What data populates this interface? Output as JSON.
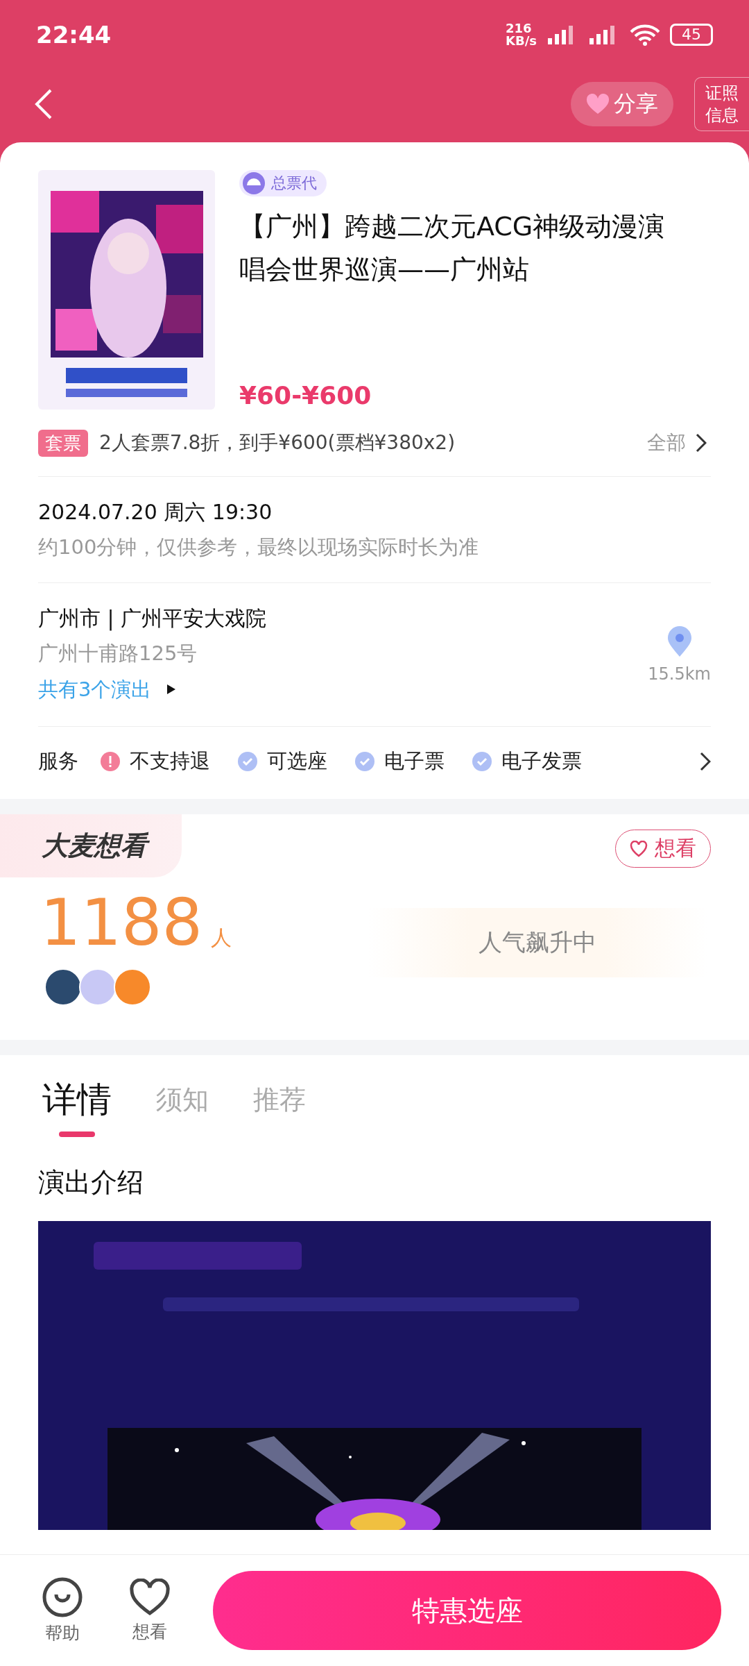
{
  "status_bar": {
    "time": "22:44",
    "net_speed": "216",
    "net_unit": "KB/s",
    "battery": "45"
  },
  "header": {
    "share": "分享",
    "license": "证照信息"
  },
  "event": {
    "badge": "总票代",
    "title": "【广州】跨越二次元ACG神级动漫演唱会世界巡演——广州站",
    "price": "¥60-¥600"
  },
  "package": {
    "tag": "套票",
    "text": "2人套票7.8折，到手¥600(票档¥380x2)",
    "more": "全部"
  },
  "schedule": {
    "datetime": "2024.07.20 周六 19:30",
    "duration": "约100分钟，仅供参考，最终以现场实际时长为准"
  },
  "venue": {
    "name": "广州市 | 广州平安大戏院",
    "address": "广州十甫路125号",
    "shows": "共有3个演出",
    "distance": "15.5km"
  },
  "services": {
    "label": "服务",
    "items": [
      {
        "kind": "warning",
        "text": "不支持退"
      },
      {
        "kind": "check",
        "text": "可选座"
      },
      {
        "kind": "check",
        "text": "电子票"
      },
      {
        "kind": "check",
        "text": "电子发票"
      }
    ]
  },
  "wants": {
    "title": "大麦想看",
    "button": "想看",
    "count": "1188",
    "unit": "人",
    "trend": "人气飙升中"
  },
  "tabs": [
    {
      "label": "详情",
      "selected": true
    },
    {
      "label": "须知",
      "selected": false
    },
    {
      "label": "推荐",
      "selected": false
    }
  ],
  "intro": {
    "heading": "演出介绍"
  },
  "bottom_bar": {
    "help": "帮助",
    "want": "想看",
    "buy": "特惠选座"
  }
}
